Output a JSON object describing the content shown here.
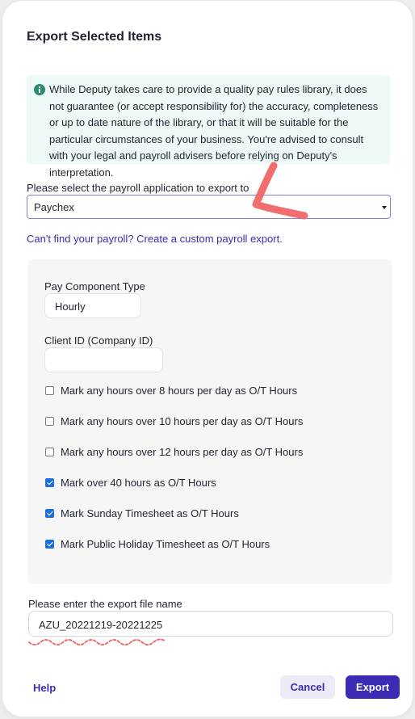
{
  "dialog": {
    "title": "Export Selected Items",
    "notice": {
      "icon": "info-icon",
      "color": "#2e8a6e",
      "text": "While Deputy takes care to provide a quality pay rules library, it does not guarantee (or accept responsibility for) the accuracy, completeness or up to date nature of the library, or that it will be suitable for the particular circumstances of your business. You're advised to consult with your legal and payroll advisers before relying on Deputy's interpretation."
    },
    "payroll_select": {
      "label": "Please select the payroll application to export to",
      "value": "Paychex"
    },
    "custom_link": "Can't find your payroll? Create a custom payroll export.",
    "settings": {
      "pay_component": {
        "label": "Pay Component Type",
        "value": "Hourly"
      },
      "client_id": {
        "label": "Client ID (Company ID)",
        "value": ""
      },
      "options": [
        {
          "label": "Mark any hours over 8 hours per day as O/T Hours",
          "checked": false
        },
        {
          "label": "Mark any hours over 10 hours per day as O/T Hours",
          "checked": false
        },
        {
          "label": "Mark any hours over 12 hours per day as O/T Hours",
          "checked": false
        },
        {
          "label": "Mark over 40 hours as O/T Hours",
          "checked": true
        },
        {
          "label": "Mark Sunday Timesheet as O/T Hours",
          "checked": true
        },
        {
          "label": "Mark Public Holiday Timesheet as O/T Hours",
          "checked": true
        }
      ]
    },
    "filename": {
      "label": "Please enter the export file name",
      "value": "AZU_20221219-20221225"
    },
    "buttons": {
      "help": "Help",
      "cancel": "Cancel",
      "export": "Export"
    },
    "colors": {
      "accent": "#3b2bb5",
      "checkbox": "#1a6fd8",
      "annotation": "#f26d6d"
    }
  }
}
